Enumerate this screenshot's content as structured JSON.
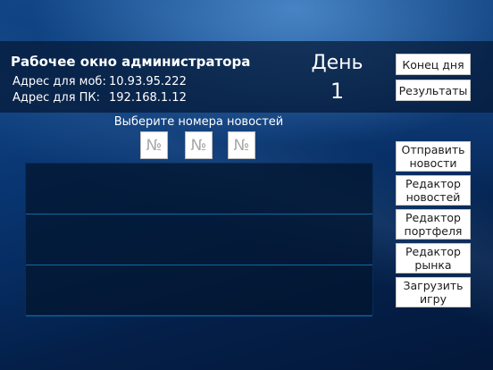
{
  "header": {
    "title": "Рабочее окно администратора",
    "mobile_address_label": "Адрес для моб:",
    "mobile_address_value": "10.93.95.222",
    "pc_address_label": "Адрес для ПК:",
    "pc_address_value": "192.168.1.12",
    "day_label": "День",
    "day_value": "1"
  },
  "buttons": {
    "end_day": "Конец дня",
    "results": "Результаты",
    "send_news": [
      "Отправить",
      "новости"
    ],
    "news_editor": [
      "Редактор",
      "новостей"
    ],
    "portfolio_editor": [
      "Редактор",
      "портфеля"
    ],
    "market_editor": [
      "Редактор",
      "рынка"
    ],
    "load_game": [
      "Загрузить",
      "игру"
    ]
  },
  "news_select": {
    "prompt": "Выберите номера новостей",
    "inputs": [
      {
        "placeholder": "№",
        "value": ""
      },
      {
        "placeholder": "№",
        "value": ""
      },
      {
        "placeholder": "№",
        "value": ""
      }
    ]
  },
  "news_list": {
    "rows": [
      "",
      "",
      ""
    ]
  },
  "colors": {
    "background_top": "#0b3f7e",
    "background_bottom": "#03183a",
    "header_band": "#041834",
    "list_divider": "#0a6ca3",
    "button_bg": "#ffffff",
    "button_text": "#1b1b1b"
  }
}
